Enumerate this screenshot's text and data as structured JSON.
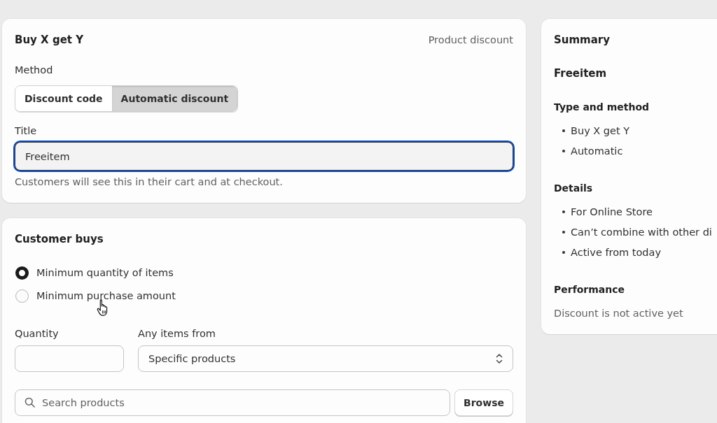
{
  "discount_card": {
    "title": "Buy X get Y",
    "type_label": "Product discount",
    "method": {
      "label": "Method",
      "options": [
        {
          "label": "Discount code",
          "selected": false
        },
        {
          "label": "Automatic discount",
          "selected": true
        }
      ]
    },
    "title_field": {
      "label": "Title",
      "value": "Freeitem",
      "focused": true,
      "help_text": "Customers will see this in their cart and at checkout."
    }
  },
  "customer_buys": {
    "title": "Customer buys",
    "requirements": [
      {
        "label": "Minimum quantity of items",
        "selected": true
      },
      {
        "label": "Minimum purchase amount",
        "selected": false
      }
    ],
    "quantity": {
      "label": "Quantity"
    },
    "items_from": {
      "label": "Any items from",
      "value": "Specific products"
    },
    "search": {
      "placeholder": "Search products"
    },
    "browse_button": "Browse"
  },
  "summary": {
    "title": "Summary",
    "discount_name": "Freeitem",
    "sections": [
      {
        "kind": "list",
        "heading": "Type and method",
        "items": [
          "Buy X get Y",
          "Automatic"
        ]
      },
      {
        "kind": "list",
        "heading": "Details",
        "items": [
          "For Online Store",
          "Can’t combine with other di",
          "Active from today"
        ]
      },
      {
        "kind": "text",
        "heading": "Performance",
        "text": "Discount is not active yet"
      }
    ]
  }
}
